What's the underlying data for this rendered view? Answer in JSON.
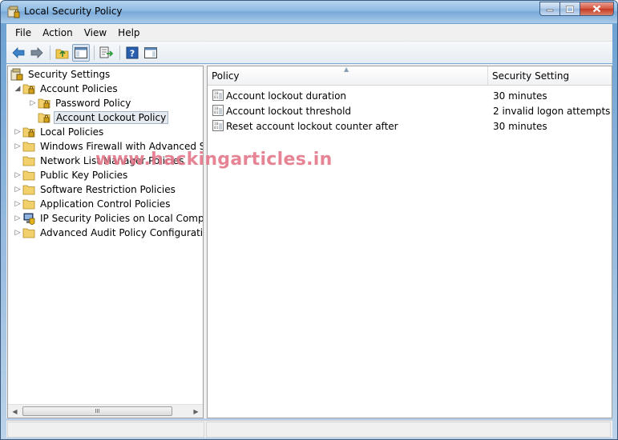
{
  "window": {
    "title": "Local Security Policy",
    "app_icon": "security-policy-icon"
  },
  "menu": [
    "File",
    "Action",
    "View",
    "Help"
  ],
  "toolbar": {
    "icons": [
      "back-arrow-icon",
      "forward-arrow-icon",
      "up-folder-icon",
      "show-hide-console-tree-icon",
      "export-list-icon",
      "help-icon",
      "show-hide-action-pane-icon"
    ]
  },
  "tree": {
    "root": "Security Settings",
    "items": [
      {
        "label": "Account Policies",
        "level": 1,
        "expanded": true,
        "icon": "locked-folder-icon"
      },
      {
        "label": "Password Policy",
        "level": 2,
        "expanded": false,
        "icon": "locked-folder-icon"
      },
      {
        "label": "Account Lockout Policy",
        "level": 2,
        "selected": true,
        "icon": "locked-folder-icon"
      },
      {
        "label": "Local Policies",
        "level": 1,
        "expanded": false,
        "icon": "locked-folder-icon"
      },
      {
        "label": "Windows Firewall with Advanced Secu",
        "level": 1,
        "expanded": false,
        "icon": "folder-icon"
      },
      {
        "label": "Network List Manager Policies",
        "level": 1,
        "icon": "folder-icon"
      },
      {
        "label": "Public Key Policies",
        "level": 1,
        "expanded": false,
        "icon": "folder-icon"
      },
      {
        "label": "Software Restriction Policies",
        "level": 1,
        "expanded": false,
        "icon": "folder-icon"
      },
      {
        "label": "Application Control Policies",
        "level": 1,
        "expanded": false,
        "icon": "folder-icon"
      },
      {
        "label": "IP Security Policies on Local Compute",
        "level": 1,
        "expanded": false,
        "icon": "ip-security-icon"
      },
      {
        "label": "Advanced Audit Policy Configuration",
        "level": 1,
        "expanded": false,
        "icon": "folder-icon"
      }
    ]
  },
  "list": {
    "columns": [
      "Policy",
      "Security Setting"
    ],
    "rows": [
      {
        "policy": "Account lockout duration",
        "setting": "30 minutes"
      },
      {
        "policy": "Account lockout threshold",
        "setting": "2 invalid logon attempts"
      },
      {
        "policy": "Reset account lockout counter after",
        "setting": "30 minutes"
      }
    ]
  },
  "watermark": "www.hackingarticles.in",
  "scrollbar": {
    "thumb_glyph": "III"
  },
  "colors": {
    "accent": "#4f81bd",
    "selection": "#e5eaf0",
    "watermark": "#d21e3c"
  }
}
